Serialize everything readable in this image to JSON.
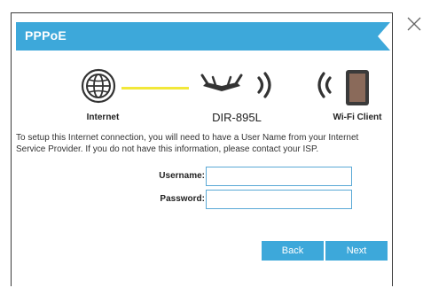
{
  "dialog": {
    "title": "PPPoE",
    "close_icon": "close-icon",
    "colors": {
      "header": "#3da8da",
      "link_line": "#f2e83a",
      "button": "#3da8da"
    }
  },
  "diagram": {
    "internet_label": "Internet",
    "device_label": "DIR-895L",
    "client_label": "Wi-Fi Client",
    "icons": [
      "globe-icon",
      "router-icon",
      "wifi-signal-icon",
      "wifi-signal-icon",
      "mobile-device-icon"
    ]
  },
  "instructions": "To setup this Internet connection, you will need to have a User Name from your Internet Service Provider. If you do not have this information, please contact your ISP.",
  "form": {
    "username_label": "Username:",
    "username_value": "",
    "password_label": "Password:",
    "password_value": ""
  },
  "buttons": {
    "back": "Back",
    "next": "Next"
  }
}
